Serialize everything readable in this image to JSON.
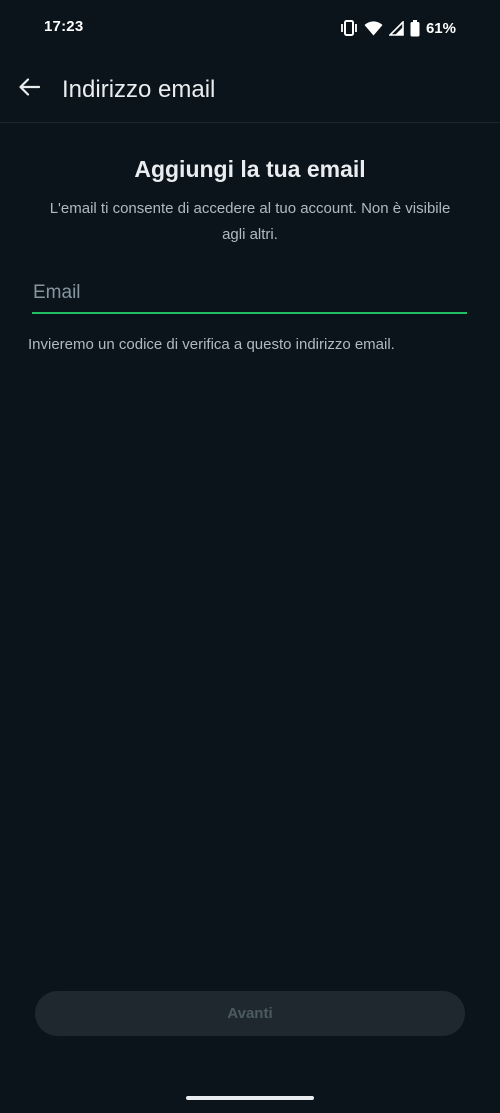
{
  "status_bar": {
    "time": "17:23",
    "battery_percent": "61%",
    "icons": [
      "vibrate-icon",
      "wifi-icon",
      "signal-icon",
      "battery-icon"
    ]
  },
  "app_bar": {
    "title": "Indirizzo email",
    "back_icon": "arrow-left-icon"
  },
  "content": {
    "heading": "Aggiungi la tua email",
    "description": "L'email ti consente di accedere al tuo account. Non è visibile agli altri.",
    "email_placeholder": "Email",
    "email_value": "",
    "helper_text": "Invieremo un codice di verifica a questo indirizzo email."
  },
  "footer": {
    "next_label": "Avanti"
  },
  "colors": {
    "background": "#0b141a",
    "accent": "#21c063",
    "text_primary": "#e9edef",
    "text_secondary": "#aebac1",
    "button_disabled_bg": "#1f282e",
    "button_disabled_text": "#4c5a62"
  }
}
